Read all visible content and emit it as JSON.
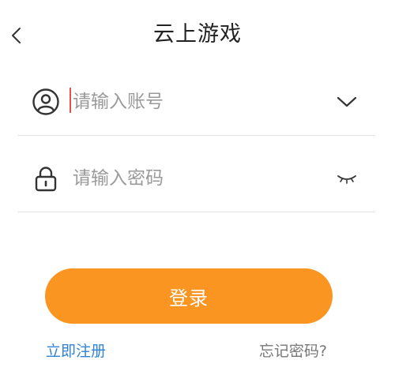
{
  "header": {
    "title": "云上游戏",
    "back_icon": "chevron-left-icon"
  },
  "form": {
    "account": {
      "placeholder": "请输入账号",
      "value": "",
      "lead_icon": "user-circle-icon",
      "trail_icon": "chevron-down-icon"
    },
    "password": {
      "placeholder": "请输入密码",
      "value": "",
      "lead_icon": "lock-icon",
      "trail_icon": "eye-closed-icon"
    }
  },
  "actions": {
    "login_label": "登录",
    "register_label": "立即注册",
    "forgot_label": "忘记密码?"
  },
  "colors": {
    "accent": "#fb9521",
    "link_blue": "#2f83d4",
    "muted_text": "#777777",
    "placeholder": "#9a9a9a",
    "caret": "#e8504a"
  }
}
